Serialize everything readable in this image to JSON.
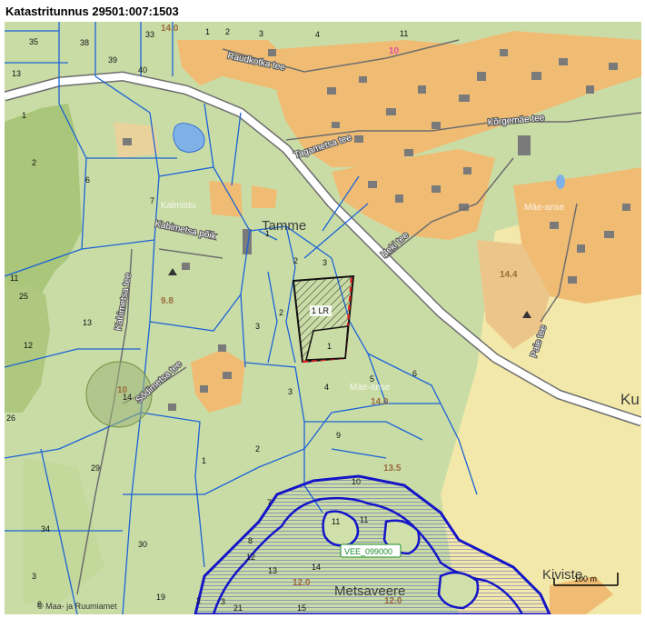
{
  "title": "Katastritunnus 29501:007:1503",
  "map": {
    "colors": {
      "background": "#c9dca6",
      "forest": "#c3d89b",
      "dark_field": "#a9c67a",
      "residential": "#f0bc74",
      "yard": "#e9d29b",
      "road_fill": "#ffffff",
      "road_edge": "#6d6d6d",
      "water": "#7fb1e6",
      "parcel_line": "#1b63d6",
      "protected_zone": "#1515c8",
      "highlight_parcel": "#111111",
      "highlight_edge": "#e02020"
    },
    "place_names": {
      "tamme": "Tamme",
      "metsaveere": "Metsaveere",
      "kiviste": "Kiviste",
      "ku": "Ku"
    },
    "faint_labels": {
      "kalmistu": "Kalmistu",
      "maeanse": "Mäe-anse",
      "maeanse2": "Mäe-anse"
    },
    "streets": {
      "raudkotka": "Raudkotka tee",
      "tagametsa": "Tagametsa tee",
      "korgemae": "Kõrgemäe tee",
      "kabimetsa": "Kabimetsa tee",
      "kabimetsa_poik": "Kabimetsa põik",
      "sodimetsa": "Sõdimetsa tee",
      "heki": "Heki tee",
      "paie": "Paie tee"
    },
    "elevations": {
      "e1": "14.0",
      "e2": "9.8",
      "e3": "14.0",
      "e4": "10",
      "e5": "14.4",
      "e6": "13.5",
      "e7": "12.0",
      "e8": "12.0",
      "e9": "10"
    },
    "parcel_numbers": {
      "p35": "35",
      "p38": "38",
      "p33": "33",
      "p1a": "1",
      "p2a": "2",
      "p3a": "3",
      "p4a": "4",
      "p11a": "11",
      "p13a": "13",
      "p39": "39",
      "p40": "40",
      "p1b": "1",
      "p2b": "2",
      "p6a": "6",
      "p7": "7",
      "p1c": "1",
      "p11b": "11",
      "p25": "25",
      "p13b": "13",
      "p12a": "12",
      "p14a": "14",
      "p26": "26",
      "p29": "29",
      "p34": "34",
      "p30": "30",
      "p3b": "3",
      "p6b": "6",
      "p19": "19",
      "p1d": "1",
      "p2c": "2",
      "p3c": "3",
      "p2d": "2",
      "p3d": "3",
      "p2e": "2",
      "p3e": "3",
      "p4b": "4",
      "p5": "5",
      "p6c": "6",
      "p9": "9",
      "p10": "10",
      "p7b": "7",
      "p11c": "11",
      "p11d": "11",
      "p8": "8",
      "p12b": "12",
      "p13c": "13",
      "p14b": "14",
      "p2f": "2",
      "p3f": "3",
      "p21": "21",
      "p15": "15",
      "p1e": "1"
    },
    "highlighted_parcel_label": "1 LR",
    "water_protection_label": "VEE_099000",
    "scale_bar": "100 m",
    "copyright": "© Maa- ja Ruumiamet"
  }
}
